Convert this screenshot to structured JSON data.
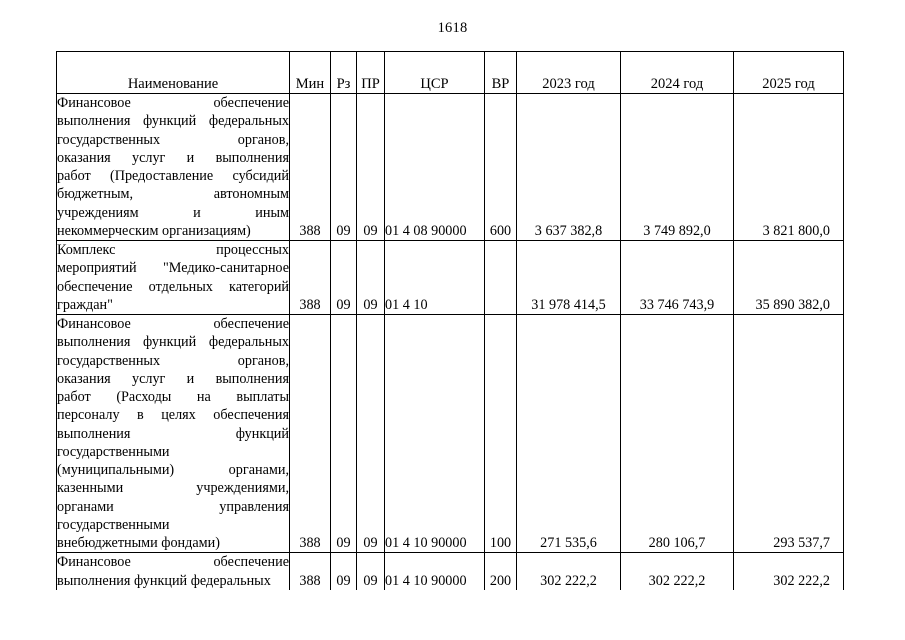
{
  "page": {
    "number": "1618"
  },
  "table": {
    "headers": {
      "name": "Наименование",
      "min": "Мин",
      "rz": "Рз",
      "pr": "ПР",
      "csr": "ЦСР",
      "vr": "ВР",
      "year1": "2023 год",
      "year2": "2024 год",
      "year3": "2025 год"
    },
    "rows": [
      {
        "name_lines": [
          "Финансовое обеспечение",
          "выполнения функций федеральных",
          "государственных органов,",
          "оказания услуг и выполнения",
          "работ (Предоставление субсидий",
          "бюджетным, автономным",
          "учреждениям и иным",
          "некоммерческим организациям)"
        ],
        "min": "388",
        "rz": "09",
        "pr": "09",
        "csr": "01 4 08 90000",
        "vr": "600",
        "year1": "3 637 382,8",
        "year2": "3 749 892,0",
        "year3": "3 821 800,0"
      },
      {
        "name_lines": [
          "Комплекс процессных",
          "мероприятий \"Медико-санитарное",
          "обеспечение отдельных категорий",
          "граждан\""
        ],
        "min": "388",
        "rz": "09",
        "pr": "09",
        "csr": "01 4 10",
        "vr": "",
        "year1": "31 978 414,5",
        "year2": "33 746 743,9",
        "year3": "35 890 382,0"
      },
      {
        "name_lines": [
          "Финансовое обеспечение",
          "выполнения функций федеральных",
          "государственных органов,",
          "оказания услуг и выполнения",
          "работ (Расходы на выплаты",
          "персоналу в целях обеспечения",
          "выполнения функций",
          "государственными",
          "(муниципальными) органами,",
          "казенными учреждениями,",
          "органами управления",
          "государственными",
          "внебюджетными фондами)"
        ],
        "min": "388",
        "rz": "09",
        "pr": "09",
        "csr": "01 4 10 90000",
        "vr": "100",
        "year1": "271 535,6",
        "year2": "280 106,7",
        "year3": "293 537,7"
      },
      {
        "name_lines": [
          "Финансовое обеспечение",
          "выполнения функций федеральных"
        ],
        "min": "388",
        "rz": "09",
        "pr": "09",
        "csr": "01 4 10 90000",
        "vr": "200",
        "year1": "302 222,2",
        "year2": "302 222,2",
        "year3": "302 222,2"
      }
    ]
  }
}
